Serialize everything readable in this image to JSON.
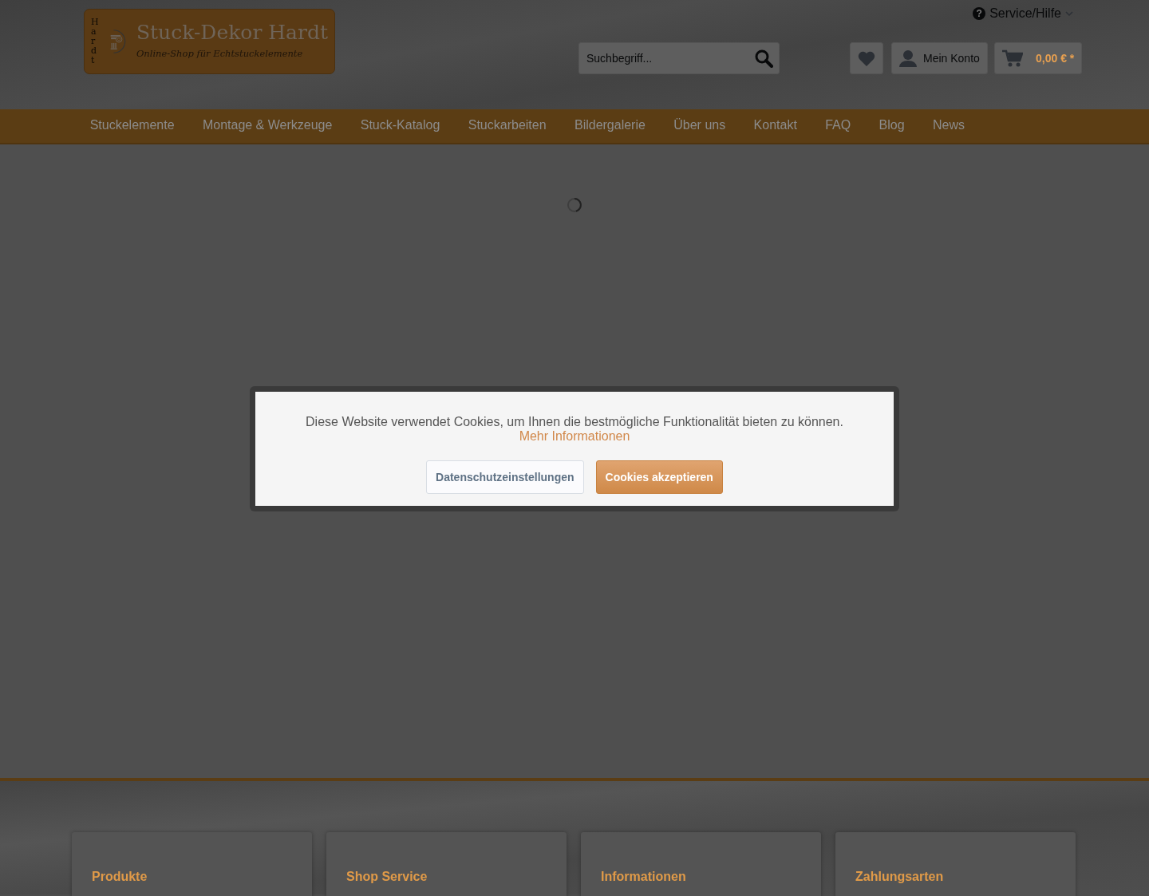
{
  "header": {
    "logo": {
      "vertical_text": "Hardt",
      "title": "Stuck-Dekor Hardt",
      "tagline": "Online-Shop für Echtstuckelemente"
    },
    "service_menu": {
      "icon": "?",
      "label": "Service/Hilfe",
      "expanded": false
    },
    "search": {
      "placeholder": "Suchbegriff..."
    },
    "account": {
      "label": "Mein Konto"
    },
    "cart": {
      "total": "0,00 € *"
    }
  },
  "navigation": [
    {
      "label": "Stuckelemente",
      "selected": false
    },
    {
      "label": "Montage & Werkzeuge",
      "selected": false
    },
    {
      "label": "Stuck-Katalog",
      "selected": false
    },
    {
      "label": "Stuckarbeiten",
      "selected": false
    },
    {
      "label": "Bildergalerie",
      "selected": false
    },
    {
      "label": "Über uns",
      "selected": false
    },
    {
      "label": "Kontakt",
      "selected": false
    },
    {
      "label": "FAQ",
      "selected": false
    },
    {
      "label": "Blog",
      "selected": false
    },
    {
      "label": "News",
      "selected": false
    }
  ],
  "cookie_notice": {
    "message": "Diese Website verwendet Cookies, um Ihnen die bestmögliche Funktionalität bieten zu können.",
    "link": "Mehr Informationen",
    "buttons": [
      {
        "label": "Datenschutzeinstellungen",
        "kind": "secondary"
      },
      {
        "label": "Cookies akzeptieren",
        "kind": "primary"
      }
    ]
  },
  "footer": {
    "columns": [
      {
        "title": "Produkte"
      },
      {
        "title": "Shop Service"
      },
      {
        "title": "Informationen"
      },
      {
        "title": "Zahlungsarten"
      }
    ]
  }
}
